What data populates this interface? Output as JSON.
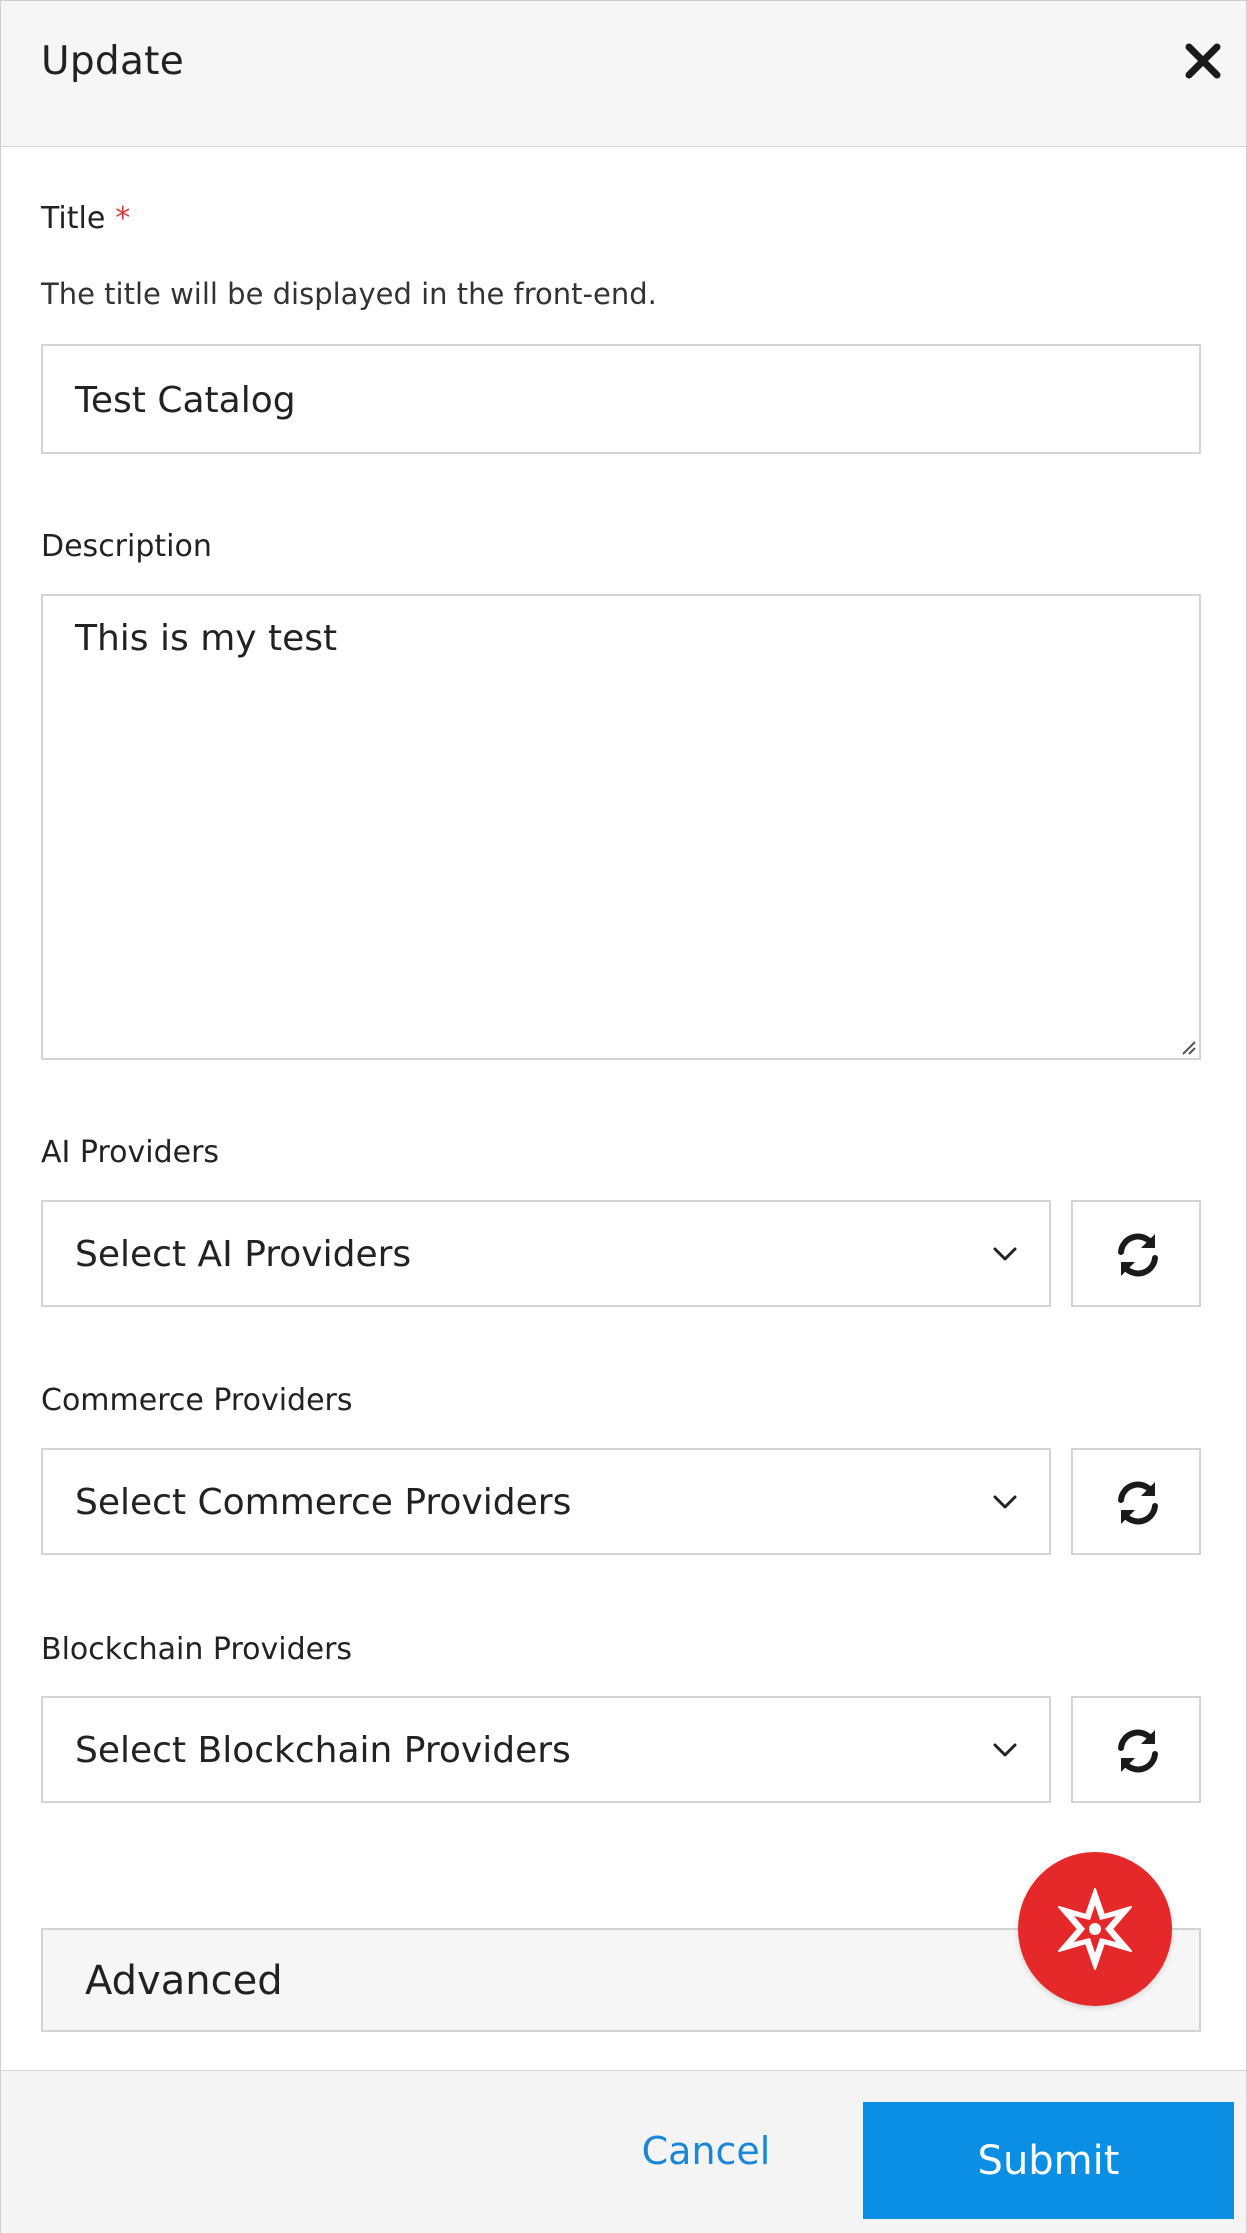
{
  "dialog": {
    "title": "Update",
    "close_icon": "close-icon"
  },
  "form": {
    "title_field": {
      "label": "Title",
      "required_marker": "*",
      "hint": "The title will be displayed in the front-end.",
      "value": "Test Catalog"
    },
    "description_field": {
      "label": "Description",
      "value": "This is my test"
    },
    "ai_providers": {
      "label": "AI Providers",
      "selected": "Select AI Providers",
      "refresh_icon": "refresh-icon"
    },
    "commerce_providers": {
      "label": "Commerce Providers",
      "selected": "Select Commerce Providers",
      "refresh_icon": "refresh-icon"
    },
    "blockchain_providers": {
      "label": "Blockchain Providers",
      "selected": "Select Blockchain Providers",
      "refresh_icon": "refresh-icon"
    },
    "advanced": {
      "label": "Advanced"
    }
  },
  "footer": {
    "cancel_label": "Cancel",
    "submit_label": "Submit"
  },
  "fab": {
    "icon": "sparkle-star-icon"
  },
  "colors": {
    "required": "#d63a3a",
    "link": "#1b86d6",
    "primary": "#0a8fe4",
    "fab": "#e52829"
  }
}
